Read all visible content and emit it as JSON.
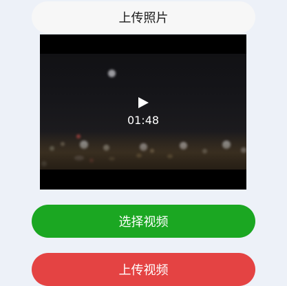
{
  "upload_photo_label": "上传照片",
  "video": {
    "duration": "01:48",
    "play_icon": "play-icon"
  },
  "select_video_label": "选择视频",
  "upload_video_label": "上传视频",
  "colors": {
    "background": "#edf1f8",
    "select_button": "#1ba722",
    "upload_button": "#e44343",
    "photo_button": "#f7f7f7"
  }
}
